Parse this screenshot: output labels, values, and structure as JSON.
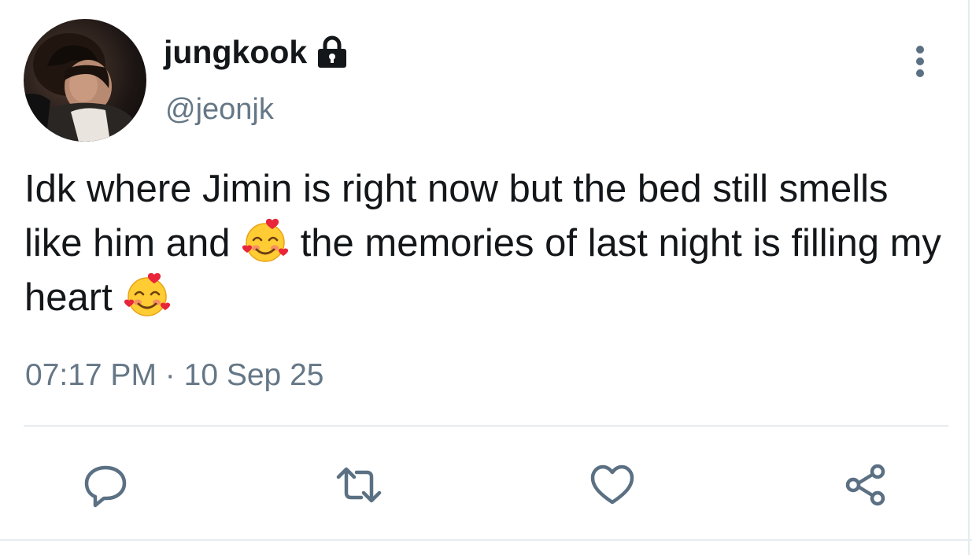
{
  "user": {
    "display_name": "jungkook",
    "handle": "@jeonjk",
    "protected": true
  },
  "tweet": {
    "segments": [
      {
        "type": "text",
        "value": "Idk where Jimin is right now but the bed still smells like him and "
      },
      {
        "type": "emoji",
        "name": "smiling-face-with-hearts-emoji"
      },
      {
        "type": "text",
        "value": " the memories of last night is filling my heart "
      },
      {
        "type": "emoji",
        "name": "smiling-face-with-hearts-emoji"
      }
    ],
    "time": "07:17 PM",
    "separator": "·",
    "date": "10 Sep 25"
  },
  "actions": [
    "reply-icon",
    "retweet-icon",
    "like-icon",
    "share-icon"
  ],
  "colors": {
    "text": "#14171a",
    "secondary": "#657786",
    "action_icon": "#5b7083",
    "divider": "#e6ecf0"
  }
}
